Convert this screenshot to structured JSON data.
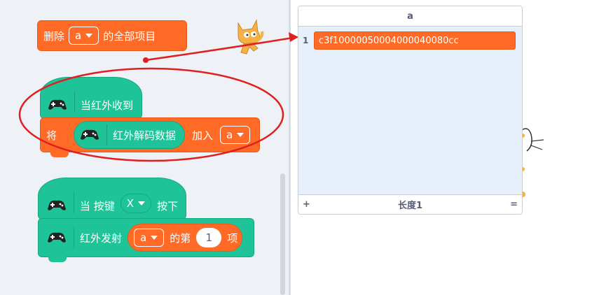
{
  "blocks": {
    "delete_all": {
      "prefix": "删除",
      "list": "a",
      "suffix": "的全部项目"
    },
    "when_ir": {
      "label": "当红外收到"
    },
    "add_to": {
      "prefix": "将",
      "reporter": "红外解码数据",
      "middle": "加入",
      "list": "a"
    },
    "when_key": {
      "prefix": "当 按键",
      "key": "X",
      "suffix": "按下"
    },
    "ir_send": {
      "prefix": "红外发射",
      "list": "a",
      "middle": "的第",
      "index": "1",
      "suffix": "项"
    }
  },
  "list_monitor": {
    "title": "a",
    "items": [
      {
        "index": "1",
        "value": "c3f10000050004000040080cc"
      }
    ],
    "add_label": "+",
    "length_label": "长度1",
    "resize_label": "="
  },
  "annotation_color": "#e02020"
}
